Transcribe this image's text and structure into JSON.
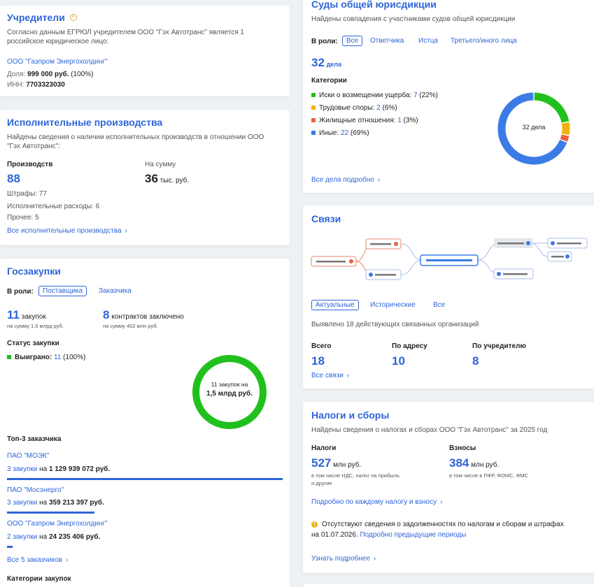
{
  "founders": {
    "title": "Учредители",
    "desc_l1": "Согласно данным ЕГРЮЛ учредителем ООО \"Гэх Автотранс\" является 1",
    "desc_l2": "российское юридическое лицо:",
    "company": "ООО \"Газпром Энергохолдинг\"",
    "share_label": "Доля: ",
    "share_value": "999 000 руб.",
    "share_pct": " (100%)",
    "inn_label": "ИНН: ",
    "inn_value": "7703323030"
  },
  "exec": {
    "title": "Исполнительные производства",
    "desc_l1": "Найдены сведения о наличии исполнительных производств в отношении ООО",
    "desc_l2": "\"Гэх Автотранс\":",
    "count_label": "Производств",
    "count_value": "88",
    "sum_label": "На сумму",
    "sum_value": "36",
    "sum_unit": "тыс. руб.",
    "fines": "Штрафы: 77",
    "expenses": "Исполнительные расходы: 6",
    "other": "Прочее: 5",
    "link": "Все исполнительные производства"
  },
  "procurement": {
    "title": "Госзакупки",
    "role_label": "В роли:",
    "role_supplier": "Поставщика",
    "role_customer": "Заказчика",
    "n_purchases": "11",
    "purchases_word": "закупок",
    "purchases_sum": "на сумму 1,5 млрд руб.",
    "n_contracts": "8",
    "contracts_word": "контрактов заключено",
    "contracts_sum": "на сумму 402 млн руб.",
    "status_label": "Статус закупки",
    "won_label": "Выиграно: ",
    "won_value": "11",
    "won_pct": " (100%)",
    "donut_l1": "11 закупок на",
    "donut_l2": "1,5 млрд руб.",
    "top3_label": "Топ-3 заказчика",
    "customers": [
      {
        "name": "ПАО \"МОЭК\"",
        "count": "3 закупки",
        "on": " на ",
        "amount": "1 129 939 072 руб.",
        "share": 1.0
      },
      {
        "name": "ПАО \"Мосэнерго\"",
        "count": "3 закупки",
        "on": " на ",
        "amount": "359 213 397 руб.",
        "share": 0.318
      },
      {
        "name": "ООО \"Газпром Энергохолдинг\"",
        "count": "2 закупки",
        "on": " на ",
        "amount": "24 235 406 руб.",
        "share": 0.021
      }
    ],
    "all_link": "Все 5 заказчиков",
    "categories_label": "Категории закупок",
    "color": "#22c01c"
  },
  "courts": {
    "title": "Суды общей юрисдикции",
    "desc": "Найдены совпадения с участниками судов общей юрисдикции",
    "role_label": "В роли:",
    "roles": [
      "Все",
      "Ответчика",
      "Истца",
      "Третьего/иного лица"
    ],
    "total": "32",
    "total_word": "дела",
    "categories_label": "Категории",
    "categories": [
      {
        "label": "Иски о возмещении ущерба: ",
        "count": "7",
        "pct": " (22%)",
        "value": 7,
        "color": "#22c01c"
      },
      {
        "label": "Трудовые споры: ",
        "count": "2",
        "pct": " (6%)",
        "value": 2,
        "color": "#f2b10f"
      },
      {
        "label": "Жилищные отношения: ",
        "count": "1",
        "pct": " (3%)",
        "value": 1,
        "color": "#e9633f"
      },
      {
        "label": "Иные: ",
        "count": "22",
        "pct": " (69%)",
        "value": 22,
        "color": "#3b7be6"
      }
    ],
    "donut_center": "32 дела",
    "link": "Все дела подробно"
  },
  "links": {
    "title": "Связи",
    "tabs": [
      "Актуальные",
      "Исторические",
      "Все"
    ],
    "desc": "Выявлено 18 действующих связанных организаций",
    "total_label": "Всего",
    "total_value": "18",
    "addr_label": "По адресу",
    "addr_value": "10",
    "founder_label": "По учредителю",
    "founder_value": "8",
    "link": "Все связи"
  },
  "taxes": {
    "title": "Налоги и сборы",
    "desc": "Найдены сведения о налогах и сборах ООО \"Гэх Автотранс\" за 2025 год",
    "tax_label": "Налоги",
    "tax_value": "527",
    "tax_unit": "млн руб.",
    "tax_note_l1": "в том числе НДС, налог на прибыль",
    "tax_note_l2": "и другие",
    "fee_label": "Взносы",
    "fee_value": "384",
    "fee_unit": "млн руб.",
    "fee_note": "в том числе в ПФР, ФОМС, ФМС",
    "detail_link": "Подробно по каждому налогу и взносу",
    "warn_l1": "Отсутствуют сведения о задолженностях по налогам и сборам и штрафах",
    "warn_l2a": "на 01.07.2026. ",
    "warn_l2b": "Подробно предыдущие периоды",
    "more_link": "Узнать подробнее"
  }
}
